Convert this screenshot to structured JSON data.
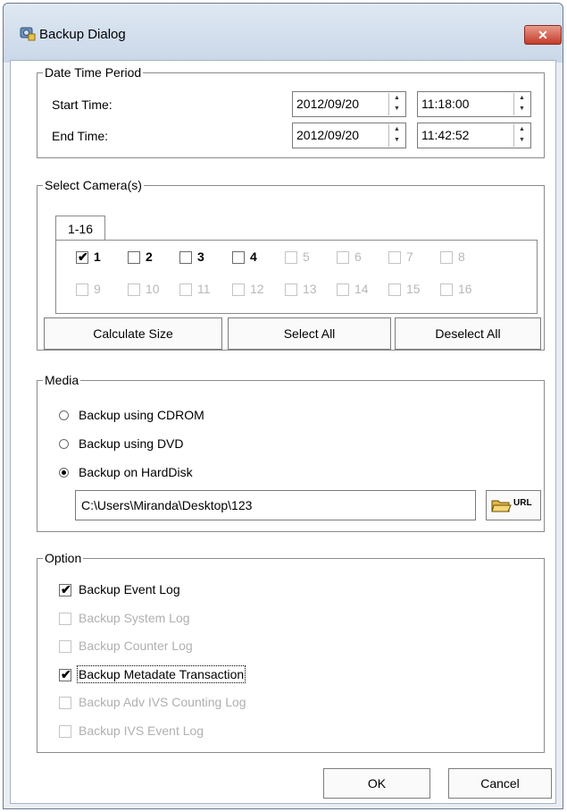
{
  "window": {
    "title": "Backup Dialog",
    "close_icon": "close-icon"
  },
  "date_time_period": {
    "legend": "Date Time Period",
    "start_label": "Start Time:",
    "end_label": "End Time:",
    "start_date": "2012/09/20",
    "start_time": "11:18:00",
    "end_date": "2012/09/20",
    "end_time": "11:42:52"
  },
  "cameras": {
    "legend": "Select Camera(s)",
    "tab": "1-16",
    "items": [
      {
        "label": "1",
        "checked": true,
        "enabled": true
      },
      {
        "label": "2",
        "checked": false,
        "enabled": true
      },
      {
        "label": "3",
        "checked": false,
        "enabled": true
      },
      {
        "label": "4",
        "checked": false,
        "enabled": true
      },
      {
        "label": "5",
        "checked": false,
        "enabled": false
      },
      {
        "label": "6",
        "checked": false,
        "enabled": false
      },
      {
        "label": "7",
        "checked": false,
        "enabled": false
      },
      {
        "label": "8",
        "checked": false,
        "enabled": false
      },
      {
        "label": "9",
        "checked": false,
        "enabled": false
      },
      {
        "label": "10",
        "checked": false,
        "enabled": false
      },
      {
        "label": "11",
        "checked": false,
        "enabled": false
      },
      {
        "label": "12",
        "checked": false,
        "enabled": false
      },
      {
        "label": "13",
        "checked": false,
        "enabled": false
      },
      {
        "label": "14",
        "checked": false,
        "enabled": false
      },
      {
        "label": "15",
        "checked": false,
        "enabled": false
      },
      {
        "label": "16",
        "checked": false,
        "enabled": false
      }
    ],
    "calculate_label": "Calculate Size",
    "select_all_label": "Select All",
    "deselect_all_label": "Deselect All"
  },
  "media": {
    "legend": "Media",
    "options": [
      {
        "label": "Backup using CDROM",
        "selected": false
      },
      {
        "label": "Backup using DVD",
        "selected": false
      },
      {
        "label": "Backup on HardDisk",
        "selected": true
      }
    ],
    "path": "C:\\Users\\Miranda\\Desktop\\123",
    "browse_label": "URL"
  },
  "option": {
    "legend": "Option",
    "items": [
      {
        "label": "Backup Event Log",
        "checked": true,
        "enabled": true
      },
      {
        "label": "Backup System Log",
        "checked": false,
        "enabled": false
      },
      {
        "label": "Backup Counter Log",
        "checked": false,
        "enabled": false
      },
      {
        "label": "Backup Metadate Transaction",
        "checked": true,
        "enabled": true
      },
      {
        "label": "Backup Adv IVS Counting Log",
        "checked": false,
        "enabled": false
      },
      {
        "label": "Backup IVS Event Log",
        "checked": false,
        "enabled": false
      }
    ]
  },
  "footer": {
    "ok_label": "OK",
    "cancel_label": "Cancel"
  }
}
